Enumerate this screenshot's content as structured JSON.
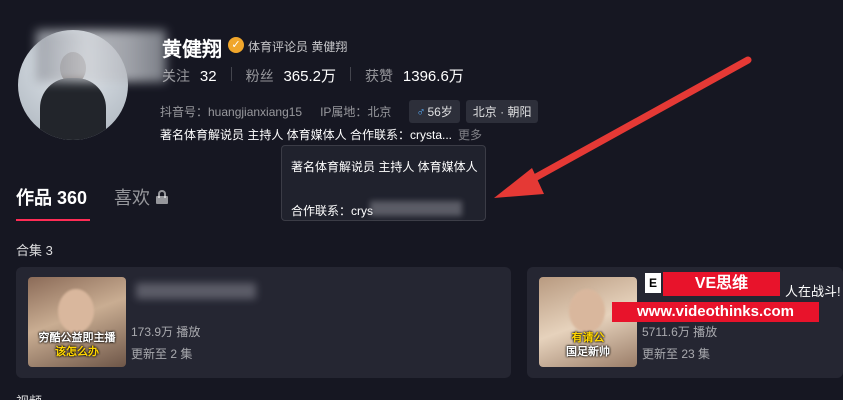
{
  "profile": {
    "name": "黄健翔",
    "verified_label": "体育评论员 黄健翔",
    "stats": [
      {
        "label": "关注",
        "value": "32"
      },
      {
        "label": "粉丝",
        "value": "365.2万"
      },
      {
        "label": "获赞",
        "value": "1396.6万"
      }
    ],
    "douyin_id": "抖音号：huangjianxiang15",
    "ip_location": "IP属地：北京",
    "tags": [
      {
        "icon": "male-icon",
        "text": "56岁"
      },
      {
        "text": "北京 · 朝阳"
      }
    ],
    "bio": "著名体育解说员 主持人 体育媒体人 合作联系：crysta...",
    "more": "更多"
  },
  "popover": {
    "line1": "著名体育解说员 主持人 体育媒体人",
    "line2": "合作联系：crys"
  },
  "tabs": {
    "works_label": "作品 360",
    "likes_label": "喜欢"
  },
  "collections": {
    "title": "合集 3",
    "cards": [
      {
        "plays": "173.9万 播放",
        "updates": "更新至 2 集",
        "thumb_caption_a": "穷酷公益即主播",
        "thumb_caption_b": "该怎么办"
      },
      {
        "plays": "5711.6万 播放",
        "updates": "更新至 23 集",
        "title_partial": "人在战斗!",
        "thumb_caption_a": "有请公",
        "thumb_caption_b": "国足新帅"
      }
    ]
  },
  "watermark": {
    "icon_text": "E",
    "brand": "VE思维",
    "url": "www.videothinks.com"
  },
  "videos_label": "视频",
  "colors": {
    "accent": "#fe2c55",
    "background": "#161722",
    "watermark": "#e8132b",
    "arrow": "#e53935"
  }
}
